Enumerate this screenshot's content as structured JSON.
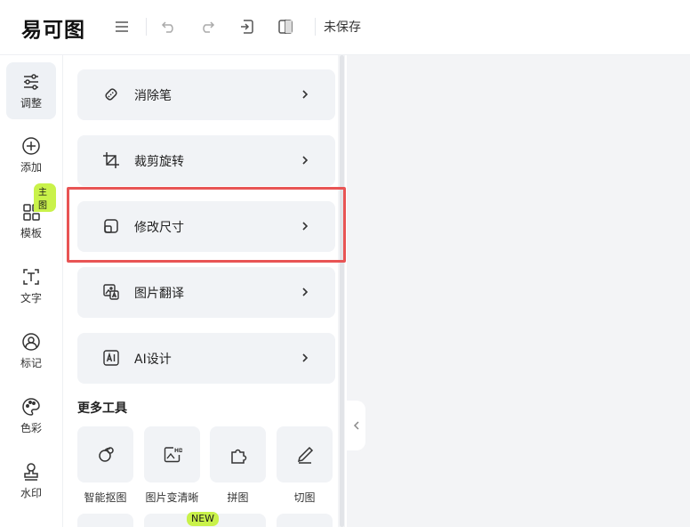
{
  "topbar": {
    "logo": "易可图",
    "menu_icon": "menu-icon",
    "undo_icon": "undo-icon",
    "redo_icon": "redo-icon",
    "import_icon": "import-icon",
    "compare_icon": "compare-icon",
    "status": "未保存"
  },
  "rail": {
    "items": [
      {
        "label": "调整",
        "icon": "sliders-icon",
        "active": true
      },
      {
        "label": "添加",
        "icon": "plus-circle-icon"
      },
      {
        "label": "模板",
        "icon": "template-grid-icon",
        "badge": "主图"
      },
      {
        "label": "文字",
        "icon": "text-icon"
      },
      {
        "label": "标记",
        "icon": "mark-icon"
      },
      {
        "label": "色彩",
        "icon": "palette-icon"
      },
      {
        "label": "水印",
        "icon": "stamp-icon"
      }
    ]
  },
  "panel": {
    "tools": [
      {
        "label": "消除笔",
        "icon": "eraser-icon"
      },
      {
        "label": "裁剪旋转",
        "icon": "crop-icon"
      },
      {
        "label": "修改尺寸",
        "icon": "resize-icon"
      },
      {
        "label": "图片翻译",
        "icon": "translate-image-icon"
      },
      {
        "label": "AI设计",
        "icon": "ai-icon"
      }
    ],
    "more_title": "更多工具",
    "grid": [
      {
        "label": "智能抠图",
        "icon": "cutout-icon"
      },
      {
        "label": "图片变清晰",
        "icon": "hd-image-icon"
      },
      {
        "label": "拼图",
        "icon": "puzzle-icon"
      },
      {
        "label": "切图",
        "icon": "slice-icon"
      }
    ],
    "new_badge": "NEW"
  },
  "colors": {
    "accent_badge": "#c9f24a",
    "highlight": "#e85454",
    "card_bg": "#f1f3f6",
    "canvas_bg": "#f3f4f6"
  }
}
